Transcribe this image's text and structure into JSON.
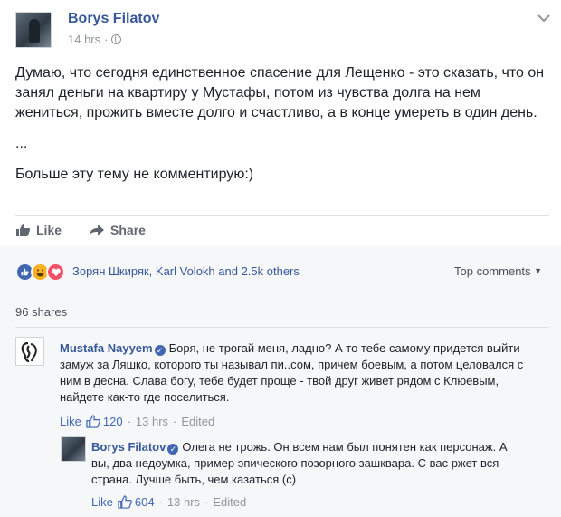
{
  "post": {
    "author": "Borys Filatov",
    "time": "14 hrs",
    "separator": "·",
    "paragraphs": [
      "Думаю, что сегодня единственное спасение для Лещенко - это сказать, что он занял деньги на квартиру у Мустафы, потом из чувства долга на нем жениться, прожить вместе долго и счастливо, а в конце умереть в один день.",
      "...",
      "Больше эту тему не комментирую:)"
    ]
  },
  "actions": {
    "like": "Like",
    "share": "Share"
  },
  "reactions": {
    "names": "Зорян Шкиряк, Karl Volokh and 2.5k others",
    "top_comments": "Top comments",
    "shares": "96 shares",
    "colors": {
      "like": "#4267b2",
      "haha": "#f7b125",
      "love": "#f25268"
    }
  },
  "comments": [
    {
      "author": "Mustafa Nayyem",
      "text": "Боря, не трогай меня, ладно? А то тебе самому придется выйти замуж за Ляшко, которого ты называл пи..сом, причем боевым, а потом целовался с ним в десна. Слава богу, тебе будет проще - твой друг живет рядом с Клюевым, найдете как-то где поселиться.",
      "like": "Like",
      "likes": "120",
      "time": "13 hrs",
      "edited": "Edited"
    },
    {
      "author": "Borys Filatov",
      "text": "Олега не трожь. Он всем нам был понятен как персонаж. А вы, два недоумка, пример эпического позорного зашквара. С вас ржет вся страна. Лучше быть, чем казаться (с)",
      "like": "Like",
      "likes": "604",
      "time": "13 hrs",
      "edited": "Edited"
    }
  ],
  "separator": "·"
}
